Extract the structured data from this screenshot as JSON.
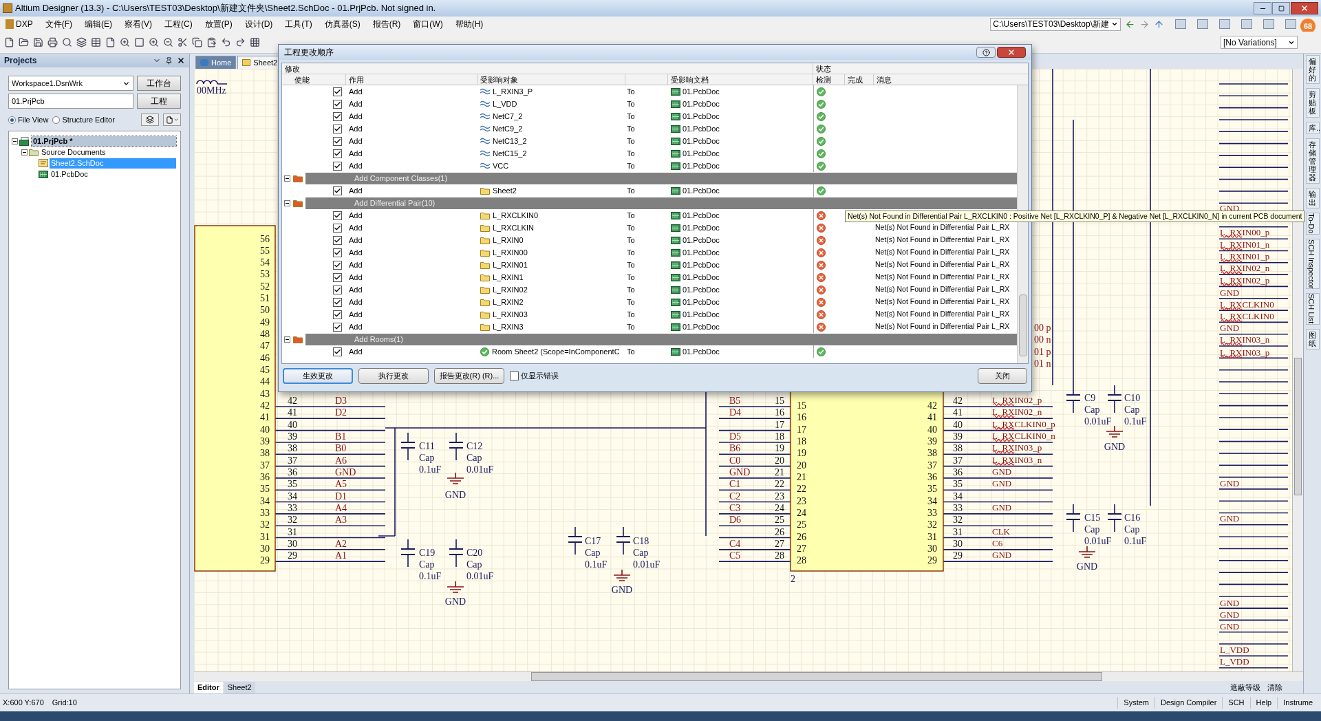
{
  "window": {
    "title": "Altium Designer (13.3) - C:\\Users\\TEST03\\Desktop\\新建文件夹\\Sheet2.SchDoc - 01.PrjPcb. Not signed in."
  },
  "menu": [
    "DXP",
    "文件(F)",
    "编辑(E)",
    "察看(V)",
    "工程(C)",
    "放置(P)",
    "设计(D)",
    "工具(T)",
    "仿真器(S)",
    "报告(R)",
    "窗口(W)",
    "帮助(H)"
  ],
  "toolbar": {
    "path": "C:\\Users\\TEST03\\Desktop\\新建",
    "variations": "[No Variations]",
    "badge": "68"
  },
  "projects_panel": {
    "title": "Projects",
    "workspace": "Workspace1.DsnWrk",
    "workspace_button": "工作台",
    "project": "01.PrjPcb",
    "project_button": "工程",
    "views": [
      {
        "label": "File View",
        "selected": true
      },
      {
        "label": "Structure Editor",
        "selected": false
      }
    ],
    "tree": [
      {
        "label": "01.PrjPcb *",
        "kind": "project",
        "focused": true,
        "selected": false,
        "expanded": true,
        "children": [
          {
            "label": "Source Documents",
            "kind": "folder",
            "focused": false,
            "selected": false,
            "expanded": true,
            "children": [
              {
                "label": "Sheet2.SchDoc",
                "kind": "schematic",
                "focused": false,
                "selected": true
              },
              {
                "label": "01.PcbDoc",
                "kind": "pcb",
                "focused": false,
                "selected": false
              }
            ]
          }
        ]
      }
    ]
  },
  "doc_tabs": [
    {
      "label": "Home",
      "selected": false
    },
    {
      "label": "Sheet2",
      "selected": true
    }
  ],
  "dialog": {
    "title": "工程更改顺序",
    "group_headers": [
      "修改",
      "状态"
    ],
    "columns": [
      "使能",
      "作用",
      "受影响对象",
      "受影响文档",
      "检测",
      "完成",
      "消息"
    ],
    "rows": [
      {
        "kind": "net",
        "enabled": true,
        "action": "Add",
        "object": "L_RXIN3_P",
        "to": "To",
        "document": "01.PcbDoc",
        "passed": true
      },
      {
        "kind": "net",
        "enabled": true,
        "action": "Add",
        "object": "L_VDD",
        "to": "To",
        "document": "01.PcbDoc",
        "passed": true
      },
      {
        "kind": "net",
        "enabled": true,
        "action": "Add",
        "object": "NetC7_2",
        "to": "To",
        "document": "01.PcbDoc",
        "passed": true
      },
      {
        "kind": "net",
        "enabled": true,
        "action": "Add",
        "object": "NetC9_2",
        "to": "To",
        "document": "01.PcbDoc",
        "passed": true
      },
      {
        "kind": "net",
        "enabled": true,
        "action": "Add",
        "object": "NetC13_2",
        "to": "To",
        "document": "01.PcbDoc",
        "passed": true
      },
      {
        "kind": "net",
        "enabled": true,
        "action": "Add",
        "object": "NetC15_2",
        "to": "To",
        "document": "01.PcbDoc",
        "passed": true
      },
      {
        "kind": "net",
        "enabled": true,
        "action": "Add",
        "object": "VCC",
        "to": "To",
        "document": "01.PcbDoc",
        "passed": true
      },
      {
        "kind": "group",
        "label": "Add Component Classes(1)",
        "expanded": true
      },
      {
        "kind": "folder",
        "enabled": true,
        "action": "Add",
        "object": "Sheet2",
        "to": "To",
        "document": "01.PcbDoc",
        "passed": true
      },
      {
        "kind": "group",
        "label": "Add Differential Pair(10)",
        "expanded": true
      },
      {
        "kind": "folder",
        "enabled": true,
        "action": "Add",
        "object": "L_RXCLKIN0",
        "to": "To",
        "document": "01.PcbDoc",
        "passed": false
      },
      {
        "kind": "folder",
        "enabled": true,
        "action": "Add",
        "object": "L_RXCLKIN",
        "to": "To",
        "document": "01.PcbDoc",
        "passed": false,
        "message": "Net(s) Not Found in Differential Pair L_RX"
      },
      {
        "kind": "folder",
        "enabled": true,
        "action": "Add",
        "object": "L_RXIN0",
        "to": "To",
        "document": "01.PcbDoc",
        "passed": false,
        "message": "Net(s) Not Found in Differential Pair L_RX"
      },
      {
        "kind": "folder",
        "enabled": true,
        "action": "Add",
        "object": "L_RXIN00",
        "to": "To",
        "document": "01.PcbDoc",
        "passed": false,
        "message": "Net(s) Not Found in Differential Pair L_RX"
      },
      {
        "kind": "folder",
        "enabled": true,
        "action": "Add",
        "object": "L_RXIN01",
        "to": "To",
        "document": "01.PcbDoc",
        "passed": false,
        "message": "Net(s) Not Found in Differential Pair L_RX"
      },
      {
        "kind": "folder",
        "enabled": true,
        "action": "Add",
        "object": "L_RXIN1",
        "to": "To",
        "document": "01.PcbDoc",
        "passed": false,
        "message": "Net(s) Not Found in Differential Pair L_RX"
      },
      {
        "kind": "folder",
        "enabled": true,
        "action": "Add",
        "object": "L_RXIN02",
        "to": "To",
        "document": "01.PcbDoc",
        "passed": false,
        "message": "Net(s) Not Found in Differential Pair L_RX"
      },
      {
        "kind": "folder",
        "enabled": true,
        "action": "Add",
        "object": "L_RXIN2",
        "to": "To",
        "document": "01.PcbDoc",
        "passed": false,
        "message": "Net(s) Not Found in Differential Pair L_RX"
      },
      {
        "kind": "folder",
        "enabled": true,
        "action": "Add",
        "object": "L_RXIN03",
        "to": "To",
        "document": "01.PcbDoc",
        "passed": false,
        "message": "Net(s) Not Found in Differential Pair L_RX"
      },
      {
        "kind": "folder",
        "enabled": true,
        "action": "Add",
        "object": "L_RXIN3",
        "to": "To",
        "document": "01.PcbDoc",
        "passed": false,
        "message": "Net(s) Not Found in Differential Pair L_RX"
      },
      {
        "kind": "group",
        "label": "Add Rooms(1)",
        "expanded": true
      },
      {
        "kind": "room",
        "enabled": true,
        "action": "Add",
        "object": "Room Sheet2 (Scope=InComponentC",
        "to": "To",
        "document": "01.PcbDoc",
        "passed": true
      }
    ],
    "buttons": [
      "生效更改",
      "执行更改",
      "报告更改(R) (R)..."
    ],
    "errors_only": {
      "label": "仅显示错误",
      "checked": false
    },
    "close": "关闭"
  },
  "tooltip": "Net(s) Not Found in Differential Pair L_RXCLKIN0 : Positive Net [L_RXCLKIN0_P] & Negative Net [L_RXCLKIN0_N] in current PCB document",
  "schematic": {
    "frequency_label": "00MHz",
    "component_a": {
      "pins": [
        "56",
        "55",
        "54",
        "53",
        "52",
        "51",
        "50",
        "49",
        "48",
        "47",
        "46",
        "45",
        "44",
        "43",
        "42",
        "41",
        "40",
        "39",
        "38",
        "37",
        "36",
        "35",
        "34",
        "33",
        "32",
        "31",
        "30",
        "29"
      ],
      "outer": [
        {
          "pin": "42",
          "net": "D3"
        },
        {
          "pin": "41",
          "net": "D2"
        },
        {
          "pin": "40"
        },
        {
          "pin": "39",
          "net": "B1"
        },
        {
          "pin": "38",
          "net": "B0"
        },
        {
          "pin": "37",
          "net": "A6"
        },
        {
          "pin": "36",
          "net": "GND"
        },
        {
          "pin": "35",
          "net": "A5"
        },
        {
          "pin": "34",
          "net": "D1"
        },
        {
          "pin": "33",
          "net": "A4"
        },
        {
          "pin": "32",
          "net": "A3"
        },
        {
          "pin": "31"
        },
        {
          "pin": "30",
          "net": "A2"
        },
        {
          "pin": "29",
          "net": "A1"
        }
      ]
    },
    "component_b": {
      "designator": "2",
      "left_inner": [
        "15",
        "16",
        "17",
        "18",
        "19",
        "20",
        "21",
        "22",
        "23",
        "24",
        "25",
        "26",
        "27",
        "28"
      ],
      "right_inner": [
        "42",
        "41",
        "40",
        "39",
        "38",
        "37",
        "36",
        "35",
        "34",
        "33",
        "32",
        "31",
        "30",
        "29"
      ],
      "left_outer": [
        {
          "pin": "15",
          "net": "B5"
        },
        {
          "pin": "16",
          "net": "D4"
        },
        {
          "pin": "17"
        },
        {
          "pin": "18",
          "net": "D5"
        },
        {
          "pin": "19",
          "net": "B6"
        },
        {
          "pin": "20",
          "net": "C0"
        },
        {
          "pin": "21",
          "net": "GND"
        },
        {
          "pin": "22",
          "net": "C1"
        },
        {
          "pin": "23",
          "net": "C2"
        },
        {
          "pin": "24",
          "net": "C3"
        },
        {
          "pin": "25",
          "net": "D6"
        },
        {
          "pin": "26"
        },
        {
          "pin": "27",
          "net": "C4"
        },
        {
          "pin": "28",
          "net": "C5"
        }
      ],
      "right_outer": [
        {
          "pin": "42",
          "net": "L_RXIN02_p",
          "error": true
        },
        {
          "pin": "41",
          "net": "L_RXIN02_n",
          "error": true
        },
        {
          "pin": "40",
          "net": "L_RXCLKIN0_p",
          "error": true
        },
        {
          "pin": "39",
          "net": "L_RXCLKIN0_n",
          "error": true
        },
        {
          "pin": "38",
          "net": "L_RXIN03_p",
          "error": true
        },
        {
          "pin": "37",
          "net": "L_RXIN03_n",
          "error": true
        },
        {
          "pin": "36",
          "net": "GND",
          "error": false
        },
        {
          "pin": "35",
          "net": "GND",
          "error": false
        },
        {
          "pin": "34"
        },
        {
          "pin": "33",
          "net": "GND",
          "error": false
        },
        {
          "pin": "32"
        },
        {
          "pin": "31",
          "net": "CLK",
          "error": false
        },
        {
          "pin": "30",
          "net": "C6",
          "error": false
        },
        {
          "pin": "29",
          "net": "GND",
          "error": false
        }
      ]
    },
    "capacitors": [
      {
        "ref": "C11",
        "type": "Cap",
        "value": "0.1uF"
      },
      {
        "ref": "C12",
        "type": "Cap",
        "value": "0.01uF"
      },
      {
        "ref": "C19",
        "type": "Cap",
        "value": "0.1uF"
      },
      {
        "ref": "C20",
        "type": "Cap",
        "value": "0.01uF"
      },
      {
        "ref": "C17",
        "type": "Cap",
        "value": "0.1uF"
      },
      {
        "ref": "C18",
        "type": "Cap",
        "value": "0.01uF"
      },
      {
        "ref": "C9",
        "type": "Cap",
        "value": "0.01uF"
      },
      {
        "ref": "C10",
        "type": "Cap",
        "value": "0.1uF"
      },
      {
        "ref": "C15",
        "type": "Cap",
        "value": "0.01uF"
      },
      {
        "ref": "C16",
        "type": "Cap",
        "value": "0.1uF"
      }
    ],
    "grounds": [
      "GND",
      "GND",
      "GND",
      "GND",
      "GND"
    ],
    "right_column": [
      {
        "net": "GND",
        "error": false
      },
      {
        "net": "L_RXIN00_p",
        "error": true
      },
      {
        "net": "L_RXIN01_n",
        "error": true
      },
      {
        "net": "L_RXIN01_p",
        "error": true
      },
      {
        "net": "L_RXIN02_n",
        "error": true
      },
      {
        "net": "L_RXIN02_p",
        "error": true
      },
      {
        "net": "GND",
        "error": false
      },
      {
        "net": "L_RXCLKIN0",
        "error": true
      },
      {
        "net": "L_RXCLKIN0",
        "error": true
      },
      {
        "net": "GND",
        "error": false
      },
      {
        "net": "L_RXIN03_n",
        "error": true
      },
      {
        "net": "L_RXIN03_p",
        "error": true
      },
      {
        "net": "GND",
        "error": false
      },
      {
        "net": "GND",
        "error": false
      },
      {
        "net": "GND",
        "error": false
      },
      {
        "net": "GND",
        "error": false
      },
      {
        "net": "GND",
        "error": false
      },
      {
        "net": "L_VDD",
        "error": false
      },
      {
        "net": "L_VDD",
        "error": false
      }
    ],
    "edge_labels": [
      "00 p",
      "00 n",
      "01 p",
      "01 n"
    ]
  },
  "editor_tabs": [
    {
      "label": "Editor",
      "selected": true
    },
    {
      "label": "Sheet2",
      "selected": false
    }
  ],
  "canvas_footer": [
    "遮蔽等级",
    "清除"
  ],
  "side_tabs": [
    {
      "label": "偏好的",
      "kind": "cjk"
    },
    {
      "label": "剪贴板",
      "kind": "cjk"
    },
    {
      "label": "库...",
      "kind": "cjk"
    },
    {
      "label": "存储管理器",
      "kind": "cjk"
    },
    {
      "label": "输出",
      "kind": "cjk"
    },
    {
      "label": "To-Do",
      "kind": "latin"
    },
    {
      "label": "SCH Inspector",
      "kind": "latin"
    },
    {
      "label": "SCH List",
      "kind": "latin"
    },
    {
      "label": "图纸",
      "kind": "cjk"
    }
  ],
  "status_bar": {
    "coords": "X:600 Y:670",
    "grid": "Grid:10",
    "panels": [
      "System",
      "Design Compiler",
      "SCH",
      "Help",
      "Instrume"
    ]
  }
}
